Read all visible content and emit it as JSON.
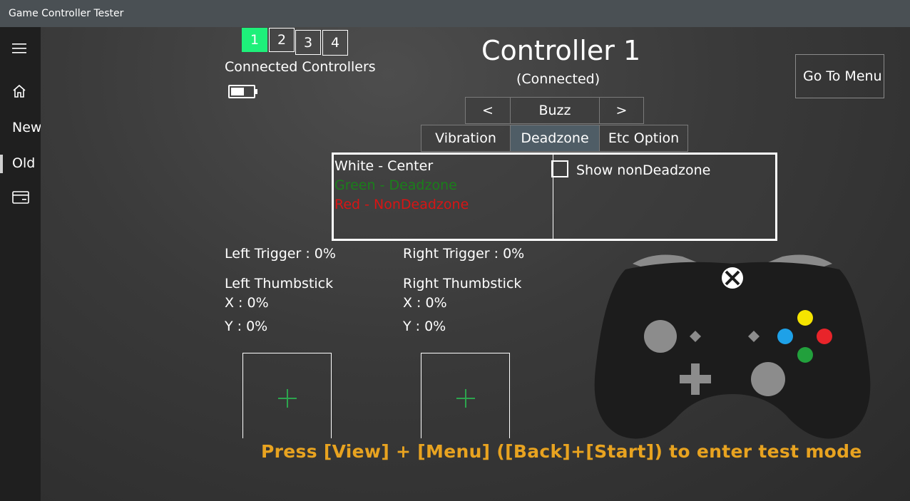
{
  "window": {
    "title": "Game Controller Tester"
  },
  "sidebar": {
    "items": [
      {
        "icon": "hamburger-icon"
      },
      {
        "icon": "home-icon"
      },
      {
        "label": "New"
      },
      {
        "label": "Old"
      },
      {
        "icon": "card-icon"
      }
    ]
  },
  "controllers": {
    "buttons": [
      "1",
      "2",
      "3",
      "4"
    ],
    "selected": "1",
    "label": "Connected Controllers",
    "battery_icon": "battery-icon"
  },
  "header": {
    "title": "Controller 1",
    "status": "(Connected)",
    "go_to_menu": "Go To Menu"
  },
  "buzz_row": {
    "prev": "<",
    "buzz": "Buzz",
    "next": ">"
  },
  "tabs": [
    "Vibration",
    "Deadzone",
    "Etc Option"
  ],
  "selected_tab": "Deadzone",
  "deadzone_panel": {
    "legend": [
      {
        "text": "White - Center",
        "color": "#ffffff"
      },
      {
        "text": "Green - Deadzone",
        "color": "#1a7f1a"
      },
      {
        "text": "Red - NonDeadzone",
        "color": "#d81414"
      }
    ],
    "checkbox_label": "Show nonDeadzone",
    "checkbox_checked": false
  },
  "readouts": {
    "left_trigger": "Left Trigger : 0%",
    "right_trigger": "Right Trigger : 0%",
    "left_thumbstick": "Left Thumbstick",
    "right_thumbstick": "Right Thumbstick",
    "left_x": "X : 0%",
    "left_y": "Y : 0%",
    "right_x": "X : 0%",
    "right_y": "Y : 0%"
  },
  "footer": {
    "test_mode": "Press [View] + [Menu] ([Back]+[Start]) to enter test mode"
  },
  "colors": {
    "accent_green": "#1ef07a",
    "gamepad_body": "#1c1c1c",
    "button_y": "#f5e400",
    "button_x": "#1ea1e8",
    "button_b": "#e8242a",
    "button_a": "#22a03c",
    "test_mode": "#e8a320"
  }
}
